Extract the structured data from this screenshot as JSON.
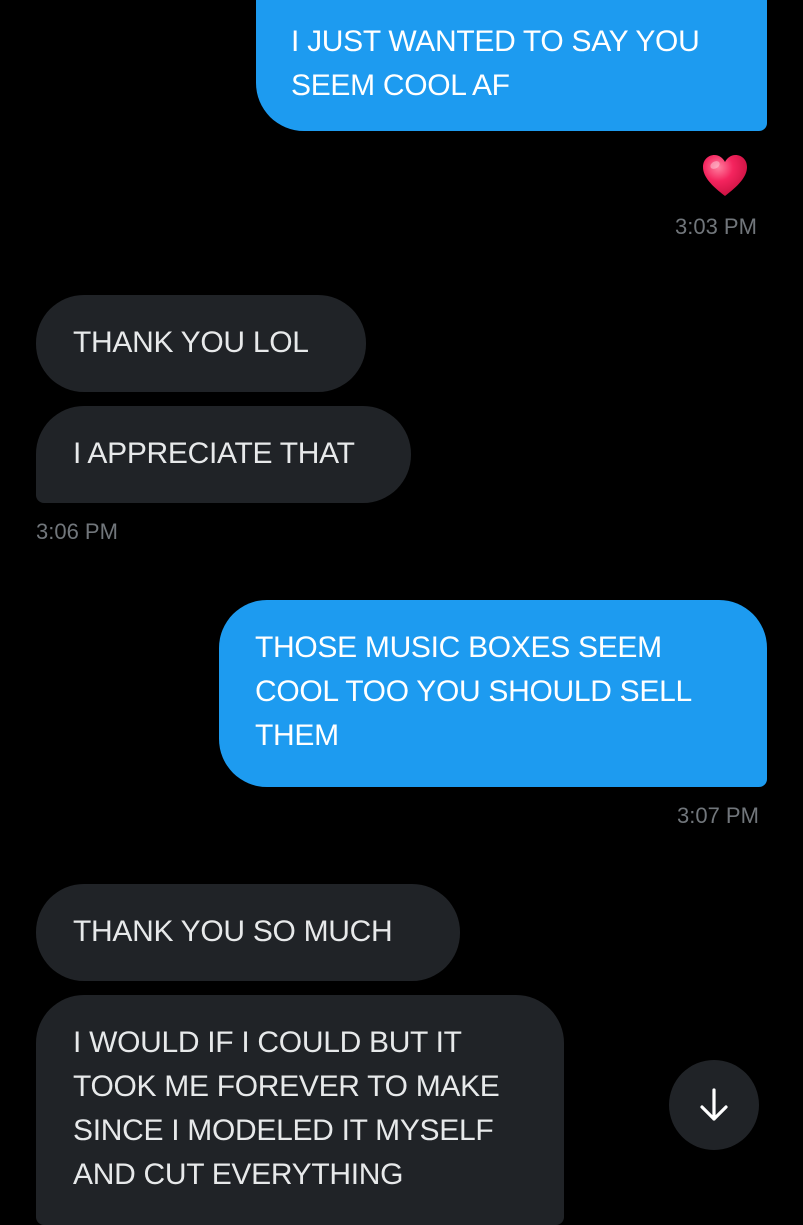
{
  "conversation": {
    "messages": [
      {
        "direction": "sent",
        "lines": [
          "I JUST WANTED TO SAY YOU",
          "SEEM COOL AF"
        ]
      },
      {
        "direction": "recv",
        "lines": [
          "THANK YOU LOL"
        ]
      },
      {
        "direction": "recv",
        "lines": [
          "I APPRECIATE THAT"
        ]
      },
      {
        "direction": "sent",
        "lines": [
          "THOSE MUSIC BOXES SEEM",
          "COOL TOO YOU SHOULD SELL",
          "THEM"
        ]
      },
      {
        "direction": "recv",
        "lines": [
          "THANK YOU SO MUCH"
        ]
      },
      {
        "direction": "recv",
        "lines": [
          "I WOULD IF I COULD BUT IT",
          "TOOK ME FOREVER TO MAKE",
          "SINCE I MODELED IT MYSELF",
          "AND CUT EVERYTHING"
        ]
      }
    ],
    "reaction": {
      "emoji": "heart-emoji",
      "color": "#f4245e"
    },
    "timestamps": [
      "3:03 PM",
      "3:06 PM",
      "3:07 PM"
    ]
  },
  "controls": {
    "scroll_down_icon": "arrow-down-icon"
  },
  "colors": {
    "background": "#000000",
    "sent_bubble": "#1d9bf0",
    "received_bubble": "#202327",
    "timestamp": "#71767b"
  }
}
